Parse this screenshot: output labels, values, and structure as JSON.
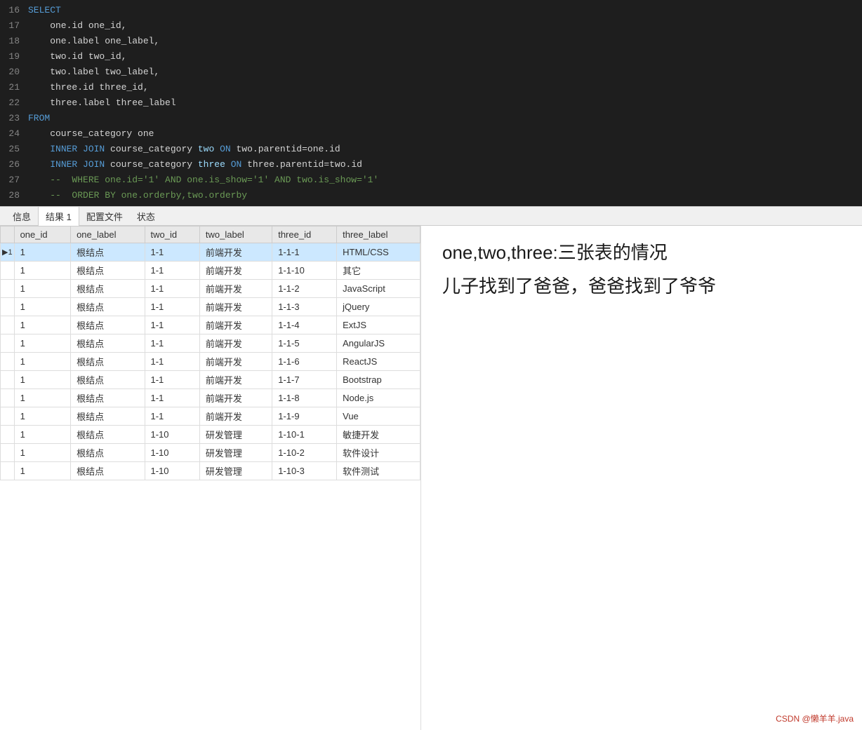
{
  "editor": {
    "lines": [
      {
        "num": "16",
        "tokens": [
          {
            "text": "SELECT",
            "cls": "kw"
          }
        ]
      },
      {
        "num": "17",
        "tokens": [
          {
            "text": "    one.id one_id,",
            "cls": "op"
          }
        ]
      },
      {
        "num": "18",
        "tokens": [
          {
            "text": "    one.label one_label,",
            "cls": "op"
          }
        ]
      },
      {
        "num": "19",
        "tokens": [
          {
            "text": "    two.id two_id,",
            "cls": "op"
          }
        ]
      },
      {
        "num": "20",
        "tokens": [
          {
            "text": "    two.label two_label,",
            "cls": "op"
          }
        ]
      },
      {
        "num": "21",
        "tokens": [
          {
            "text": "    three.id three_id,",
            "cls": "op"
          }
        ]
      },
      {
        "num": "22",
        "tokens": [
          {
            "text": "    three.label three_label",
            "cls": "op"
          }
        ]
      },
      {
        "num": "23",
        "tokens": [
          {
            "text": "FROM",
            "cls": "kw"
          }
        ]
      },
      {
        "num": "24",
        "tokens": [
          {
            "text": "    course_category one",
            "cls": "op"
          }
        ]
      },
      {
        "num": "25",
        "tokens": [
          {
            "text": "    INNER JOIN course_category two ON two.parentid=one.id",
            "cls": "mixed25"
          }
        ]
      },
      {
        "num": "26",
        "tokens": [
          {
            "text": "    INNER JOIN course_category three ON three.parentid=two.id",
            "cls": "mixed26"
          }
        ]
      },
      {
        "num": "27",
        "tokens": [
          {
            "text": "    --  WHERE one.id='1' AND one.is_show='1' AND two.is_show='1'",
            "cls": "cm"
          }
        ]
      },
      {
        "num": "28",
        "tokens": [
          {
            "text": "    --  ORDER BY one.orderby,two.orderby",
            "cls": "cm"
          }
        ]
      }
    ]
  },
  "tabs": {
    "items": [
      "信息",
      "结果 1",
      "配置文件",
      "状态"
    ],
    "active": "结果 1"
  },
  "table": {
    "headers": [
      "",
      "one_id",
      "one_label",
      "two_id",
      "two_label",
      "three_id",
      "three_label"
    ],
    "rows": [
      [
        "▶1",
        "1",
        "根结点",
        "1-1",
        "前端开发",
        "1-1-1",
        "HTML/CSS"
      ],
      [
        "",
        "1",
        "根结点",
        "1-1",
        "前端开发",
        "1-1-10",
        "其它"
      ],
      [
        "",
        "1",
        "根结点",
        "1-1",
        "前端开发",
        "1-1-2",
        "JavaScript"
      ],
      [
        "",
        "1",
        "根结点",
        "1-1",
        "前端开发",
        "1-1-3",
        "jQuery"
      ],
      [
        "",
        "1",
        "根结点",
        "1-1",
        "前端开发",
        "1-1-4",
        "ExtJS"
      ],
      [
        "",
        "1",
        "根结点",
        "1-1",
        "前端开发",
        "1-1-5",
        "AngularJS"
      ],
      [
        "",
        "1",
        "根结点",
        "1-1",
        "前端开发",
        "1-1-6",
        "ReactJS"
      ],
      [
        "",
        "1",
        "根结点",
        "1-1",
        "前端开发",
        "1-1-7",
        "Bootstrap"
      ],
      [
        "",
        "1",
        "根结点",
        "1-1",
        "前端开发",
        "1-1-8",
        "Node.js"
      ],
      [
        "",
        "1",
        "根结点",
        "1-1",
        "前端开发",
        "1-1-9",
        "Vue"
      ],
      [
        "",
        "1",
        "根结点",
        "1-10",
        "研发管理",
        "1-10-1",
        "敏捷开发"
      ],
      [
        "",
        "1",
        "根结点",
        "1-10",
        "研发管理",
        "1-10-2",
        "软件设计"
      ],
      [
        "",
        "1",
        "根结点",
        "1-10",
        "研发管理",
        "1-10-3",
        "软件测试"
      ]
    ]
  },
  "annotation": {
    "line1": "one,two,three:三张表的情况",
    "line2": "儿子找到了爸爸，爸爸找到了爷爷"
  },
  "watermark": "CSDN @懒羊羊.java"
}
